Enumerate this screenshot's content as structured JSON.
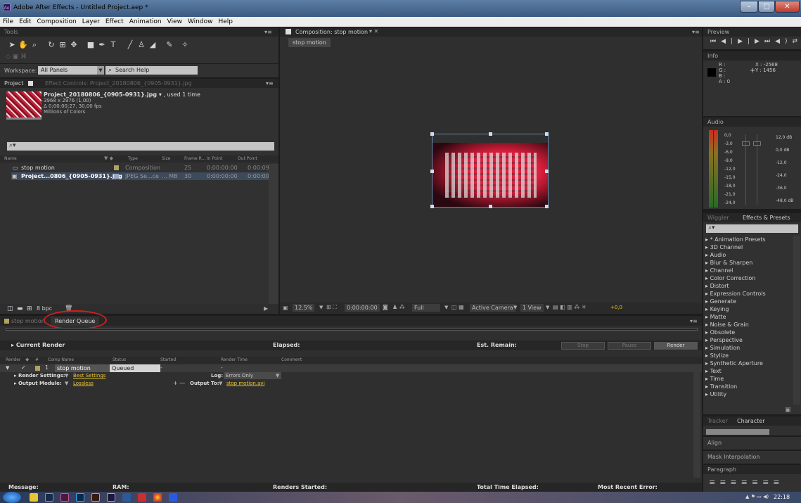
{
  "window": {
    "title": "Adobe After Effects - Untitled Project.aep *",
    "app_icon": "Ae",
    "minimize": "–",
    "maximize": "□",
    "close": "✕"
  },
  "menu": [
    "File",
    "Edit",
    "Composition",
    "Layer",
    "Effect",
    "Animation",
    "View",
    "Window",
    "Help"
  ],
  "tools_panel": {
    "tab": "Tools"
  },
  "workspace": {
    "label": "Workspace:",
    "value": "All Panels",
    "search_placeholder": "Search Help"
  },
  "project": {
    "tab": "Project",
    "effect_controls_tab": "Effect Controls: Project_20180806_{0905-0931}.jpg",
    "preview": {
      "name": "Project_20180806_{0905-0931}.jpg",
      "used": "▾ , used 1 time",
      "dims": "3968 x 2976 (1,00)",
      "duration": "Δ 0;00;00;27, 30,00 fps",
      "colors": "Millions of Colors"
    },
    "search_placeholder": "",
    "columns": [
      "Name",
      "Type",
      "Size",
      "Frame R...",
      "In Point",
      "Out Point"
    ],
    "rows": [
      {
        "name": "stop motion",
        "type": "Composition",
        "size": "",
        "fps": "25",
        "in": "0:00:00:00",
        "out": "0:00:09:0"
      },
      {
        "name": "Project...0806_{0905-0931}.jpg",
        "type": "JPEG Se...ce",
        "size": "... MB",
        "fps": "30",
        "in": "0:00:00:00",
        "out": "0:00:00:2"
      }
    ],
    "bpc": "8 bpc"
  },
  "composition": {
    "tab": "Composition: stop motion",
    "tab_sub": "stop motion",
    "zoom": "12.5%",
    "timecode": "0:00:00:00",
    "resolution": "Full",
    "camera": "Active Camera",
    "view": "1 View",
    "exposure": "+0,0"
  },
  "preview_panel": {
    "tab": "Preview",
    "controls": [
      "⏮",
      "◀|",
      "▶",
      "|▶",
      "⏭",
      "◀)",
      "⇄",
      "⇢"
    ]
  },
  "info_panel": {
    "tab": "Info",
    "r": "R :",
    "g": "G :",
    "b": "B :",
    "a": "A : 0",
    "x": "X : -2568",
    "y": "Y : 1456"
  },
  "audio_panel": {
    "tab": "Audio",
    "left_scale": [
      "0,0",
      "-3,0",
      "-6,0",
      "-9,0",
      "-12,0",
      "-15,0",
      "-18,0",
      "-21,0",
      "-24,0"
    ],
    "right_scale": [
      "12,0 dB",
      "0,0 dB",
      "-12,0",
      "-24,0",
      "-36,0",
      "-48,0 dB"
    ]
  },
  "effects_panel": {
    "tabs": [
      "Wiggler",
      "Effects & Presets"
    ],
    "search_placeholder": "",
    "items": [
      "* Animation Presets",
      "3D Channel",
      "Audio",
      "Blur & Sharpen",
      "Channel",
      "Color Correction",
      "Distort",
      "Expression Controls",
      "Generate",
      "Keying",
      "Matte",
      "Noise & Grain",
      "Obsolete",
      "Perspective",
      "Simulation",
      "Stylize",
      "Synthetic Aperture",
      "Text",
      "Time",
      "Transition",
      "Utility"
    ]
  },
  "tracker_panel": {
    "tabs": [
      "Tracker",
      "Character"
    ]
  },
  "align_panel": {
    "tab": "Align"
  },
  "mask_panel": {
    "tab": "Mask Interpolation"
  },
  "paragraph_panel": {
    "tab": "Paragraph"
  },
  "bottom_tabs": {
    "timeline": "stop motion",
    "render_queue": "Render Queue"
  },
  "render_queue": {
    "current_render": "Current Render",
    "elapsed": "Elapsed:",
    "est_remain": "Est. Remain:",
    "stop": "Stop",
    "pause": "Pause",
    "render": "Render",
    "columns": [
      "Render",
      "#",
      "Comp Name",
      "Status",
      "Started",
      "Render Time",
      "Comment"
    ],
    "item": {
      "num": "1",
      "comp": "stop motion",
      "status": "Queued",
      "started": "-",
      "render_time": "-"
    },
    "render_settings_label": "Render Settings:",
    "render_settings_value": "Best Settings",
    "log_label": "Log:",
    "log_value": "Errors Only",
    "output_module_label": "Output Module:",
    "output_module_value": "Lossless",
    "output_to_label": "Output To:",
    "output_to_value": "stop motion.avi"
  },
  "status_bar": {
    "message": "Message:",
    "ram": "RAM:",
    "renders_started": "Renders Started:",
    "total_time": "Total Time Elapsed:",
    "recent_error": "Most Recent Error:"
  },
  "taskbar": {
    "time": "22:18",
    "tray": "▲ ⚑ ▭ ◀)"
  },
  "colors": {
    "accent": "#e8c530",
    "annotation": "#d02020"
  }
}
